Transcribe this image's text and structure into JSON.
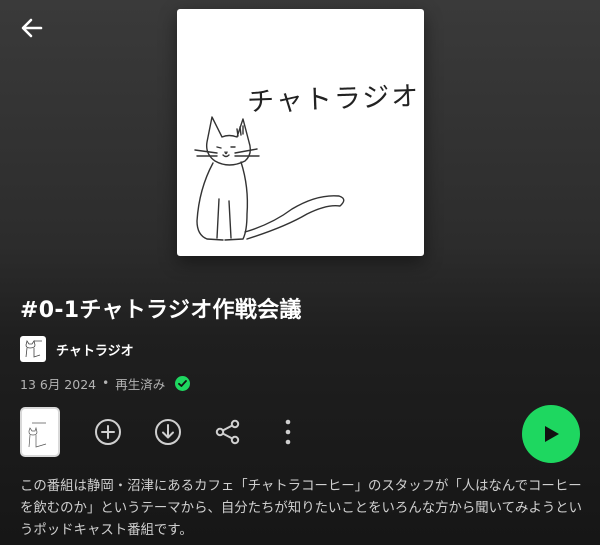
{
  "header": {
    "back_icon": "arrow-left-icon"
  },
  "cover": {
    "title": "チャトラジオ",
    "illustration": "cat-drawing"
  },
  "episode": {
    "title": "#0-1チャトラジオ作戦会議",
    "show_name": "チャトラジオ",
    "date": "13 6月 2024",
    "separator": "•",
    "status": "再生済み",
    "description": "この番組は静岡・沼津にあるカフェ「チャトラコーヒー」のスタッフが「人はなんでコーヒーを飲むのか」というテーマから、自分たちが知りたいことをいろんな方から聞いてみようというポッドキャスト番組です。"
  },
  "actions": {
    "add_icon": "plus-circle-icon",
    "download_icon": "download-circle-icon",
    "share_icon": "share-icon",
    "more_icon": "more-vertical-icon",
    "play_icon": "play-icon"
  },
  "colors": {
    "accent": "#1ed760",
    "background_top": "#3a3a3a",
    "background_bottom": "#161616",
    "secondary_text": "#b3b3b3"
  }
}
